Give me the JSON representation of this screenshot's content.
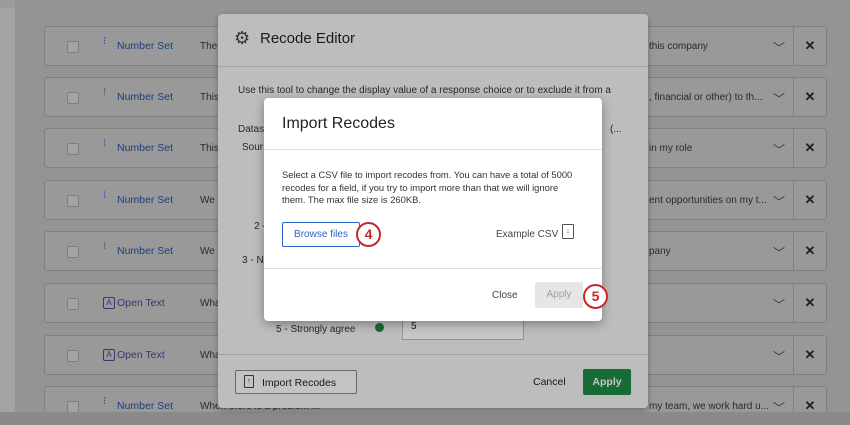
{
  "rows": [
    {
      "type": "Number Set",
      "icon": "number-set-icon",
      "left_text": "Ther",
      "right_text": "this company"
    },
    {
      "type": "Number Set",
      "icon": "number-set-icon",
      "left_text": "This",
      "right_text": ", financial or other) to th..."
    },
    {
      "type": "Number Set",
      "icon": "number-set-icon",
      "left_text": "This",
      "right_text": "in my role"
    },
    {
      "type": "Number Set",
      "icon": "number-set-icon",
      "left_text": "We a",
      "right_text": "ent opportunities on my t..."
    },
    {
      "type": "Number Set",
      "icon": "number-set-icon",
      "left_text": "We a",
      "right_text": "pany"
    },
    {
      "type": "Open Text",
      "icon": "open-text-icon",
      "left_text": "Wha",
      "right_text": ""
    },
    {
      "type": "Open Text",
      "icon": "open-text-icon",
      "left_text": "Wha",
      "right_text": ""
    },
    {
      "type": "Number Set",
      "icon": "number-set-icon",
      "left_text": "When there is a problem ...",
      "right_text": "my team, we work hard u..."
    }
  ],
  "editor": {
    "title": "Recode Editor",
    "description": "Use this tool to change the display value of a response choice or to exclude it from a",
    "labels": {
      "datas": "Datas",
      "sour": "Sour",
      "two": "2 -",
      "three": "3 - N",
      "five": "5 - Strongly agree",
      "ellipsis": "(..."
    },
    "value_5": "5",
    "import_label": "Import Recodes",
    "cancel_label": "Cancel",
    "apply_label": "Apply"
  },
  "dialog": {
    "title": "Import Recodes",
    "description": "Select a CSV file to import recodes from. You can have a total of 5000 recodes for a field, if you try to import more than that we will ignore them. The max file size is 260KB.",
    "browse_label": "Browse files",
    "example_label": "Example CSV",
    "close_label": "Close",
    "apply_label": "Apply"
  },
  "markers": {
    "browse": "4",
    "apply": "5"
  },
  "colors": {
    "accent_blue": "#2a63c8",
    "accent_green": "#1e8a44",
    "marker_red": "#c62828",
    "open_text_purple": "#6a4bb6"
  }
}
